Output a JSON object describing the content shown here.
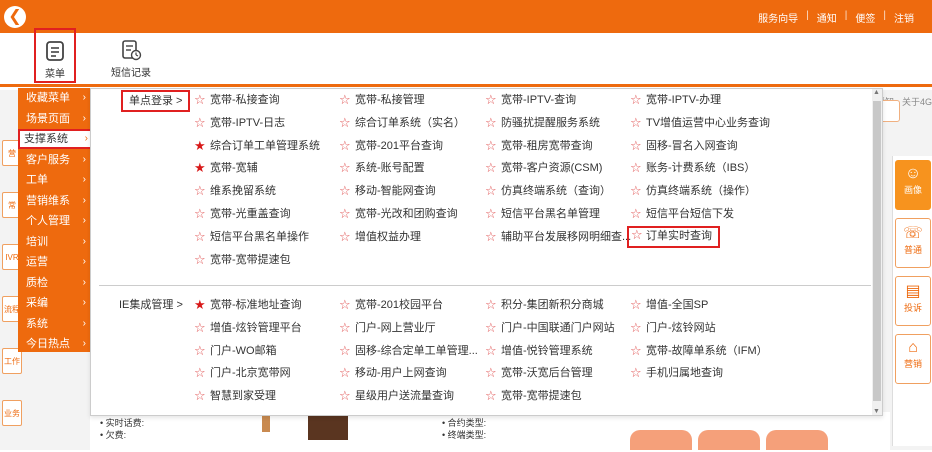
{
  "topbar": {
    "back_icon": "back-arrow-icon",
    "links": [
      "服务向导",
      "通知",
      "便签",
      "注销"
    ]
  },
  "toolbar": {
    "menu_label": "菜单",
    "sms_label": "短信记录"
  },
  "background": {
    "notice_text": "现场通知 · 关于4G",
    "search_placeholder": "码",
    "right_panel": [
      "画像",
      "普通",
      "投诉",
      "营销"
    ],
    "left_strip": [
      "营",
      "常",
      "IVR",
      "流程",
      "工作",
      "业务"
    ],
    "bottom_texts": [
      "• 实时话费:",
      "• 欠费:",
      "• 合约类型:",
      "• 终端类型:"
    ]
  },
  "category_menu": [
    {
      "label": "收藏菜单",
      "active": false
    },
    {
      "label": "场景页面",
      "active": false
    },
    {
      "label": "支撑系统",
      "active": true
    },
    {
      "label": "客户服务",
      "active": false
    },
    {
      "label": "工单",
      "active": false
    },
    {
      "label": "营销维系",
      "active": false
    },
    {
      "label": "个人管理",
      "active": false
    },
    {
      "label": "培训",
      "active": false
    },
    {
      "label": "运营",
      "active": false
    },
    {
      "label": "质检",
      "active": false
    },
    {
      "label": "采编",
      "active": false
    },
    {
      "label": "系统",
      "active": false
    },
    {
      "label": "今日热点",
      "active": false
    }
  ],
  "sections": [
    {
      "title": "单点登录 >",
      "items": [
        [
          "宽带-私接查询",
          "宽带-私接管理",
          "宽带-IPTV-查询",
          "宽带-IPTV-办理"
        ],
        [
          "宽带-IPTV-日志",
          "综合订单系统（实名）",
          "防骚扰提醒服务系统",
          "TV增值运营中心业务查询"
        ],
        [
          "综合订单工单管理系统",
          "宽带-201平台查询",
          "宽带-租房宽带查询",
          "固移-冒名入网查询"
        ],
        [
          "宽带-宽辅",
          "系统-账号配置",
          "宽带-客户资源(CSM)",
          "账务-计费系统（IBS）"
        ],
        [
          "维系挽留系统",
          "移动-智能网查询",
          "仿真终端系统（查询）",
          "仿真终端系统（操作）"
        ],
        [
          "宽带-光重盖查询",
          "宽带-光改和团购查询",
          "短信平台黑名单管理",
          "短信平台短信下发"
        ],
        [
          "短信平台黑名单操作",
          "增值权益办理",
          "辅助平台发展移网明细查...",
          "订单实时查询"
        ],
        [
          "宽带-宽带提速包"
        ]
      ],
      "filled": [
        "综合订单工单管理系统",
        "宽带-宽辅"
      ],
      "highlighted": "订单实时查询"
    },
    {
      "title": "IE集成管理 >",
      "items": [
        [
          "宽带-标准地址查询",
          "宽带-201校园平台",
          "积分-集团新积分商城",
          "增值-全国SP"
        ],
        [
          "增值-炫铃管理平台",
          "门户-网上营业厅",
          "门户-中国联通门户网站",
          "门户-炫铃网站"
        ],
        [
          "门户-WO邮箱",
          "固移-综合定单工单管理...",
          "增值-悦铃管理系统",
          "宽带-故障单系统（IFM）"
        ],
        [
          "门户-北京宽带网",
          "移动-用户上网查询",
          "宽带-沃宽后台管理",
          "手机归属地查询"
        ],
        [
          "智慧到家受理",
          "星级用户送流量查询",
          "宽带-宽带提速包"
        ]
      ],
      "filled": [
        "宽带-标准地址查询"
      ]
    }
  ],
  "icons": {
    "star": "star-icon",
    "chevron": "chevron-right-icon"
  },
  "colors": {
    "accent": "#ee6a0e",
    "highlight": "#e02020"
  }
}
